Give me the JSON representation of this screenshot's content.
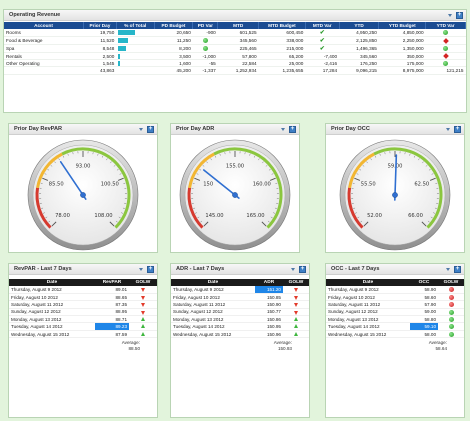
{
  "revenue": {
    "title": "Operating Revenue",
    "headers": [
      "Account",
      "Prior Day",
      "% of Total",
      "PD Budget",
      "PD Var",
      "MTD",
      "MTD Budget",
      "MTD Var",
      "YTD",
      "YTD Budget",
      "YTD Var"
    ],
    "rows": [
      {
        "account": "Rooms",
        "prior_day": "19,750",
        "pct_of_total": 0.46,
        "pd_budget": "20,650",
        "pd_var": "-900",
        "mtd": "601,525",
        "mtd_budget": "600,450",
        "mtd_var": "",
        "mtd_var_icon": "check-icon",
        "ytd": "4,950,250",
        "ytd_budget": "4,850,000",
        "ytd_var": "",
        "ytd_var_icon": "green-dot"
      },
      {
        "account": "Food & Beverage",
        "prior_day": "11,520",
        "pct_of_total": 0.27,
        "pd_budget": "11,250",
        "pd_var": "",
        "pd_var_icon": "green-dot",
        "mtd": "345,560",
        "mtd_budget": "338,000",
        "mtd_var": "",
        "mtd_var_icon": "check-icon",
        "ytd": "2,125,850",
        "ytd_budget": "2,250,000",
        "ytd_var": "",
        "ytd_var_icon": "red-diamond"
      },
      {
        "account": "Spa",
        "prior_day": "8,548",
        "pct_of_total": 0.2,
        "pd_budget": "8,200",
        "pd_var": "",
        "pd_var_icon": "green-dot",
        "mtd": "225,465",
        "mtd_budget": "215,000",
        "mtd_var": "",
        "mtd_var_icon": "check-icon",
        "ytd": "1,496,365",
        "ytd_budget": "1,350,000",
        "ytd_var": "",
        "ytd_var_icon": "green-dot"
      },
      {
        "account": "Rentals",
        "prior_day": "2,500",
        "pct_of_total": 0.06,
        "pd_budget": "3,500",
        "pd_var": "-1,000",
        "mtd": "57,800",
        "mtd_budget": "65,200",
        "mtd_var": "-7,400",
        "ytd": "345,560",
        "ytd_budget": "350,000",
        "ytd_var": "",
        "ytd_var_icon": "red-diamond"
      },
      {
        "account": "Other Operating",
        "prior_day": "1,545",
        "pct_of_total": 0.035,
        "pd_budget": "1,600",
        "pd_var": "-55",
        "mtd": "22,584",
        "mtd_budget": "25,000",
        "mtd_var": "-2,416",
        "ytd": "176,250",
        "ytd_budget": "175,000",
        "ytd_var": "",
        "ytd_var_icon": "green-dot"
      }
    ],
    "total": {
      "prior_day": "43,863",
      "pd_budget": "45,200",
      "pd_var": "-1,337",
      "mtd": "1,252,934",
      "mtd_budget": "1,235,655",
      "mtd_var": "17,284",
      "ytd": "9,096,215",
      "ytd_budget": "8,975,000",
      "ytd_var": "121,215"
    }
  },
  "gauges": [
    {
      "title": "Prior Day RevPAR",
      "value": 89.23,
      "min": 78.0,
      "max": 108.0,
      "ticks": [
        "78.00",
        "85.50",
        "93.00",
        "100.50",
        "108.00"
      ]
    },
    {
      "title": "Prior Day ADR",
      "value": 151.2,
      "min": 145.0,
      "max": 165.0,
      "ticks": [
        "145.00",
        "150",
        "155.00",
        "160.00",
        "165.00"
      ]
    },
    {
      "title": "Prior Day OCC",
      "value": 59.1,
      "min": 52.0,
      "max": 66.0,
      "ticks": [
        "52.00",
        "55.50",
        "59.00",
        "62.50",
        "66.00"
      ]
    }
  ],
  "last7": [
    {
      "title": "RevPAR - Last 7 Days",
      "headers": [
        "Date",
        "RevPAR",
        "GOLW"
      ],
      "rows": [
        {
          "date": "Thursday, August 9 2012",
          "value": "89.01",
          "golw": "down-arrow"
        },
        {
          "date": "Friday, August 10 2012",
          "value": "88.65",
          "golw": "down-arrow"
        },
        {
          "date": "Saturday, August 11 2012",
          "value": "87.35",
          "golw": "down-arrow"
        },
        {
          "date": "Sunday, August 12 2012",
          "value": "88.95",
          "golw": "down-arrow"
        },
        {
          "date": "Monday, August 13 2012",
          "value": "88.71",
          "golw": "up-arrow"
        },
        {
          "date": "Tuesday, August 14 2012",
          "value": "89.23",
          "golw": "up-arrow",
          "highlight": true
        },
        {
          "date": "Wednesday, August 15 2012",
          "value": "87.59",
          "golw": "up-arrow"
        }
      ],
      "avg_label": "Average:",
      "avg_value": "88.50"
    },
    {
      "title": "ADR - Last 7 Days",
      "headers": [
        "Date",
        "ADR",
        "GOLW"
      ],
      "rows": [
        {
          "date": "Thursday, August 9 2012",
          "value": "151.20",
          "golw": "down-arrow",
          "highlight": true
        },
        {
          "date": "Friday, August 10 2012",
          "value": "150.85",
          "golw": "down-arrow"
        },
        {
          "date": "Saturday, August 11 2012",
          "value": "150.90",
          "golw": "down-arrow"
        },
        {
          "date": "Sunday, August 12 2012",
          "value": "150.77",
          "golw": "down-arrow"
        },
        {
          "date": "Monday, August 13 2012",
          "value": "150.86",
          "golw": "up-arrow"
        },
        {
          "date": "Tuesday, August 14 2012",
          "value": "150.95",
          "golw": "up-arrow"
        },
        {
          "date": "Wednesday, August 15 2012",
          "value": "150.96",
          "golw": "up-arrow"
        }
      ],
      "avg_label": "Average:",
      "avg_value": "150.93"
    },
    {
      "title": "OCC - Last 7 Days",
      "headers": [
        "Date",
        "OCC",
        "GOLW"
      ],
      "rows": [
        {
          "date": "Thursday, August 9 2012",
          "value": "58.90",
          "golw": "red-dot"
        },
        {
          "date": "Friday, August 10 2012",
          "value": "58.60",
          "golw": "red-dot"
        },
        {
          "date": "Saturday, August 11 2012",
          "value": "57.90",
          "golw": "red-dot"
        },
        {
          "date": "Sunday, August 12 2012",
          "value": "59.00",
          "golw": "green-dot"
        },
        {
          "date": "Monday, August 13 2012",
          "value": "58.80",
          "golw": "green-dot"
        },
        {
          "date": "Tuesday, August 14 2012",
          "value": "59.10",
          "golw": "green-dot",
          "highlight": true
        },
        {
          "date": "Wednesday, August 15 2012",
          "value": "58.00",
          "golw": "green-dot"
        }
      ],
      "avg_label": "Average:",
      "avg_value": "58.64"
    }
  ],
  "colors": {
    "accent": "#1b4c92",
    "highlight": "#1f86e8",
    "pct_bar": "#26b6c9",
    "page_bg": "#e2f4dc"
  }
}
